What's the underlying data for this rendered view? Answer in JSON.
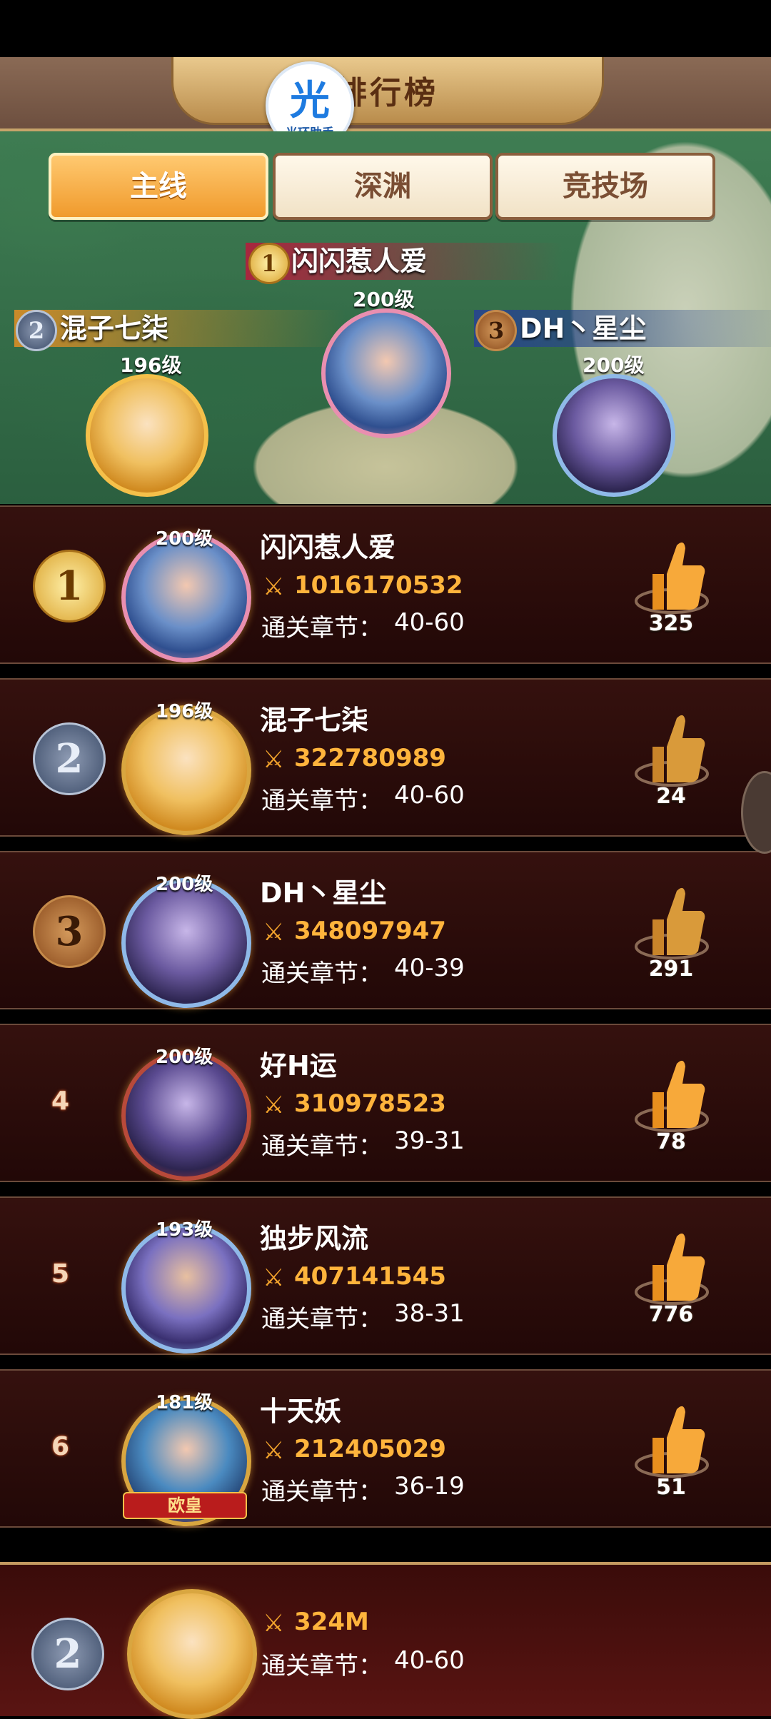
{
  "header": {
    "title": "排行榜",
    "helper_badge": {
      "glyph": "光",
      "sub": "光环助手"
    },
    "back_icon": "back-arrow-icon"
  },
  "tabs": [
    {
      "label": "主线",
      "active": true
    },
    {
      "label": "深渊",
      "active": false
    },
    {
      "label": "竞技场",
      "active": false
    }
  ],
  "podium": [
    {
      "rank": "1",
      "name": "闪闪惹人爱",
      "level": "200级"
    },
    {
      "rank": "2",
      "name": "混子七柒",
      "level": "196级"
    },
    {
      "rank": "3",
      "name": "DH丶星尘",
      "level": "200级"
    }
  ],
  "chapter_label": "通关章节：",
  "rows": [
    {
      "rank": "1",
      "level": "200级",
      "name": "闪闪惹人爱",
      "power": "1016170532",
      "chapter": "40-60",
      "likes": "325"
    },
    {
      "rank": "2",
      "level": "196级",
      "name": "混子七柒",
      "power": "322780989",
      "chapter": "40-60",
      "likes": "24"
    },
    {
      "rank": "3",
      "level": "200级",
      "name": "DH丶星尘",
      "power": "348097947",
      "chapter": "40-39",
      "likes": "291"
    },
    {
      "rank": "4",
      "level": "200级",
      "name": "好H运",
      "power": "310978523",
      "chapter": "39-31",
      "likes": "78"
    },
    {
      "rank": "5",
      "level": "193级",
      "name": "独步风流",
      "power": "407141545",
      "chapter": "38-31",
      "likes": "776"
    },
    {
      "rank": "6",
      "level": "181级",
      "name": "十天妖",
      "power": "212405029",
      "chapter": "36-19",
      "likes": "51",
      "banner": "欧皇"
    }
  ],
  "self": {
    "rank": "2",
    "power": "324M",
    "chapter": "40-60"
  },
  "colors": {
    "gold": "#d9a12c",
    "power": "#ffb43c",
    "row_bg": "#2a0c0a",
    "tab_active": "#f09a2c"
  }
}
